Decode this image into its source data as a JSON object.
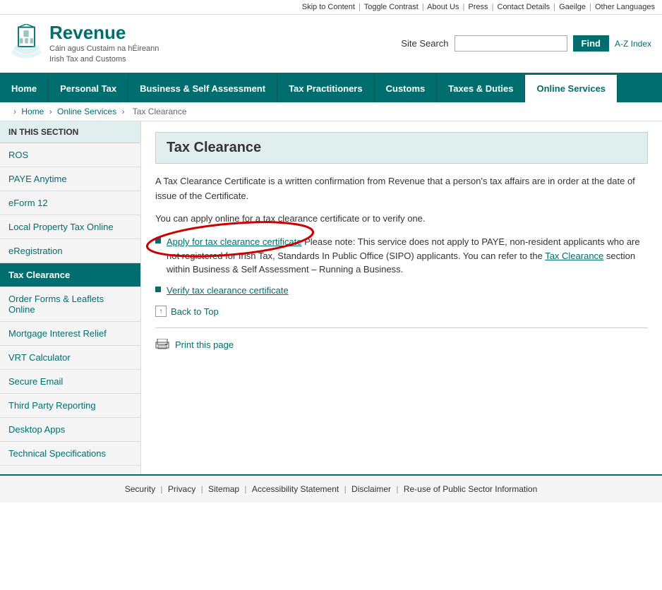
{
  "topbar": {
    "skip": "Skip to Content",
    "toggle": "Toggle Contrast",
    "about": "About Us",
    "press": "Press",
    "contact": "Contact Details",
    "gaeilge": "Gaeilge",
    "languages": "Other Languages"
  },
  "header": {
    "revenue": "Revenue",
    "tagline1": "Cáin agus Custaim na hÉireann",
    "tagline2": "Irish Tax and Customs",
    "search_label": "Site Search",
    "search_placeholder": "",
    "find_btn": "Find",
    "az": "A-Z Index"
  },
  "nav": {
    "items": [
      {
        "label": "Home",
        "active": false
      },
      {
        "label": "Personal Tax",
        "active": false
      },
      {
        "label": "Business & Self Assessment",
        "active": false
      },
      {
        "label": "Tax Practitioners",
        "active": false
      },
      {
        "label": "Customs",
        "active": false
      },
      {
        "label": "Taxes & Duties",
        "active": false
      },
      {
        "label": "Online Services",
        "active": true
      }
    ]
  },
  "breadcrumb": {
    "home": "Home",
    "online_services": "Online Services",
    "current": "Tax Clearance"
  },
  "sidebar": {
    "section_title": "IN THIS SECTION",
    "items": [
      {
        "label": "ROS",
        "active": false
      },
      {
        "label": "PAYE Anytime",
        "active": false
      },
      {
        "label": "eForm 12",
        "active": false
      },
      {
        "label": "Local Property Tax Online",
        "active": false
      },
      {
        "label": "eRegistration",
        "active": false
      },
      {
        "label": "Tax Clearance",
        "active": true
      },
      {
        "label": "Order Forms & Leaflets Online",
        "active": false
      },
      {
        "label": "Mortgage Interest Relief",
        "active": false
      },
      {
        "label": "VRT Calculator",
        "active": false
      },
      {
        "label": "Secure Email",
        "active": false
      },
      {
        "label": "Third Party Reporting",
        "active": false
      },
      {
        "label": "Desktop Apps",
        "active": false
      },
      {
        "label": "Technical Specifications",
        "active": false
      }
    ]
  },
  "main": {
    "page_title": "Tax Clearance",
    "intro1": "A Tax Clearance Certificate is a written confirmation from Revenue that a person's tax affairs are in order at the date of issue of the Certificate.",
    "intro2": "You can apply online for a tax clearance certificate or to verify one.",
    "bullet1_link": "Apply for tax clearance certificate",
    "bullet1_note": " Please note: This service does not apply to PAYE, non-resident applicants who are not registered for Irish Tax, Standards In Public Office (SIPO) applicants. You can refer to the ",
    "bullet1_link2": "Tax Clearance",
    "bullet1_note2": " section within Business & Self Assessment – Running a Business.",
    "bullet2_link": "Verify tax clearance certificate",
    "back_to_top": "Back to Top",
    "print_link": "Print this page"
  },
  "footer": {
    "items": [
      "Security",
      "Privacy",
      "Sitemap",
      "Accessibility Statement",
      "Disclaimer",
      "Re-use of Public Sector Information"
    ]
  }
}
